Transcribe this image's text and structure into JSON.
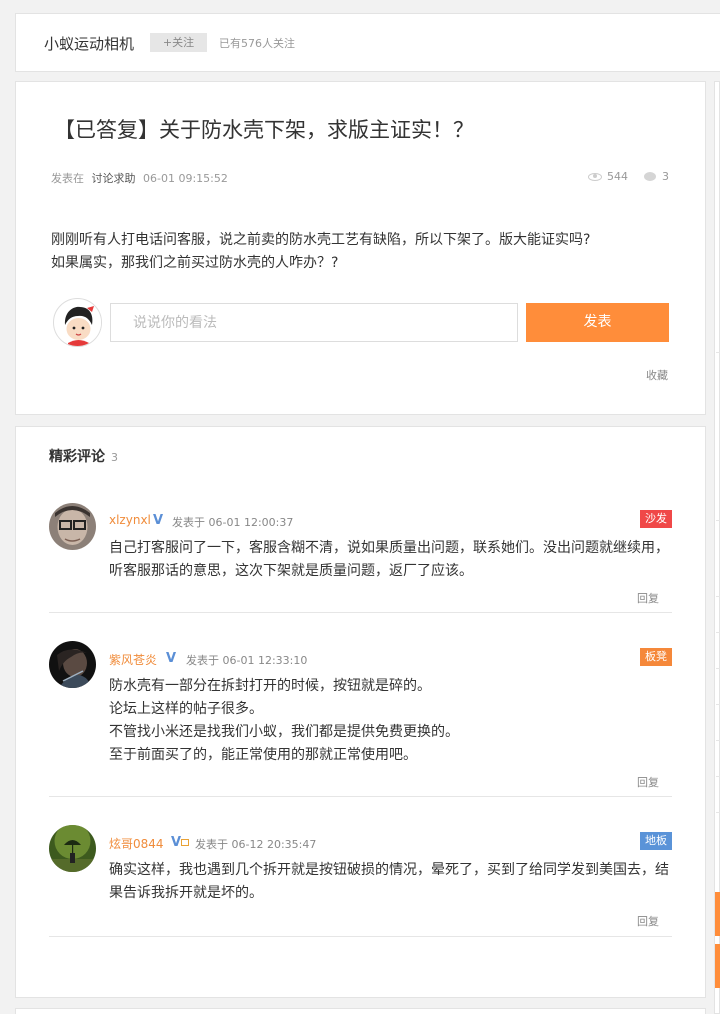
{
  "header": {
    "channel_name": "小蚁运动相机",
    "follow_label": "+关注",
    "follower_text": "已有576人关注"
  },
  "post": {
    "title": "【已答复】关于防水壳下架，求版主证实！？",
    "posted_in_label": "发表在",
    "category": "讨论求助",
    "datetime": "06-01 09:15:52",
    "views": "544",
    "replies": "3",
    "body_lines": [
      "刚刚听有人打电话问客服，说之前卖的防水壳工艺有缺陷，所以下架了。版大能证实吗?",
      "如果属实，那我们之前买过防水壳的人咋办？?"
    ],
    "reply_placeholder": "说说你的看法",
    "submit_label": "发表",
    "collect_label": "收藏"
  },
  "comments_section": {
    "heading": "精彩评论",
    "count": "3",
    "comments": [
      {
        "username": "xlzynxl",
        "badge": "V",
        "posted_label": "发表于",
        "datetime": "06-01 12:00:37",
        "floor": "沙发",
        "floor_color": "#f04848",
        "text": "自己打客服问了一下，客服含糊不清，说如果质量出问题，联系她们。没出问题就继续用，听客服那话的意思，这次下架就是质量问题，返厂了应该。",
        "reply_label": "回复"
      },
      {
        "username": "紫风苍炎",
        "badge": "V",
        "posted_label": "发表于",
        "datetime": "06-01 12:33:10",
        "floor": "板凳",
        "floor_color": "#f5883a",
        "text_lines": [
          "防水壳有一部分在拆封打开的时候，按钮就是碎的。",
          "论坛上这样的帖子很多。",
          "不管找小米还是找我们小蚁，我们都是提供免费更换的。",
          "至于前面买了的，能正常使用的那就正常使用吧。"
        ],
        "reply_label": "回复"
      },
      {
        "username": "炫哥0844",
        "badge": "V",
        "posted_label": "发表于",
        "datetime": "06-12 20:35:47",
        "floor": "地板",
        "floor_color": "#5a93d8",
        "text": "确实这样，我也遇到几个拆开就是按钮破损的情况，晕死了，买到了给同学发到美国去，结果告诉我拆开就是坏的。",
        "reply_label": "回复"
      }
    ]
  },
  "colors": {
    "accent": "#ff8d3a",
    "username": "#f08c3b",
    "vip_badge": "#5b8fd6"
  },
  "icons": {
    "views": "eye-icon",
    "replies": "comment-bubble-icon"
  }
}
